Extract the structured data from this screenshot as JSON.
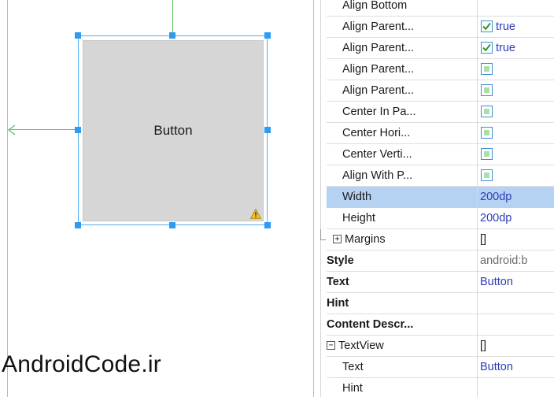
{
  "canvas": {
    "widget_label": "Button",
    "watermark": "AndroidCode.ir"
  },
  "properties": {
    "rows": [
      {
        "label": "Align Bottom",
        "value": "",
        "bold": false,
        "kind": "text"
      },
      {
        "label": "Align Parent...",
        "value": "true",
        "bold": false,
        "kind": "check-true"
      },
      {
        "label": "Align Parent...",
        "value": "true",
        "bold": false,
        "kind": "check-true"
      },
      {
        "label": "Align Parent...",
        "value": "",
        "bold": false,
        "kind": "check-empty"
      },
      {
        "label": "Align Parent...",
        "value": "",
        "bold": false,
        "kind": "check-empty"
      },
      {
        "label": "Center In Pa...",
        "value": "",
        "bold": false,
        "kind": "check-empty"
      },
      {
        "label": "Center Hori...",
        "value": "",
        "bold": false,
        "kind": "check-empty"
      },
      {
        "label": "Center Verti...",
        "value": "",
        "bold": false,
        "kind": "check-empty"
      },
      {
        "label": "Align With P...",
        "value": "",
        "bold": false,
        "kind": "check-empty"
      },
      {
        "label": "Width",
        "value": "200dp",
        "bold": false,
        "kind": "text",
        "selected": true
      },
      {
        "label": "Height",
        "value": "200dp",
        "bold": false,
        "kind": "text"
      },
      {
        "label": "Margins",
        "value": "[]",
        "bold": false,
        "kind": "group"
      },
      {
        "label": "Style",
        "value": "android:b",
        "bold": true,
        "kind": "text-muted"
      },
      {
        "label": "Text",
        "value": "Button",
        "bold": true,
        "kind": "text"
      },
      {
        "label": "Hint",
        "value": "",
        "bold": true,
        "kind": "text"
      },
      {
        "label": "Content Descr...",
        "value": "",
        "bold": true,
        "kind": "text"
      },
      {
        "label": "TextView",
        "value": "[]",
        "bold": false,
        "kind": "group-open"
      },
      {
        "label": "Text",
        "value": "Button",
        "bold": false,
        "kind": "text"
      },
      {
        "label": "Hint",
        "value": "",
        "bold": false,
        "kind": "text"
      }
    ]
  },
  "colors": {
    "selection": "#b6d2f3",
    "value_blue": "#2c3cb6",
    "handle_blue": "#2e9bf0",
    "constraint_green": "#5cc35c",
    "button_gray": "#d6d6d6"
  }
}
